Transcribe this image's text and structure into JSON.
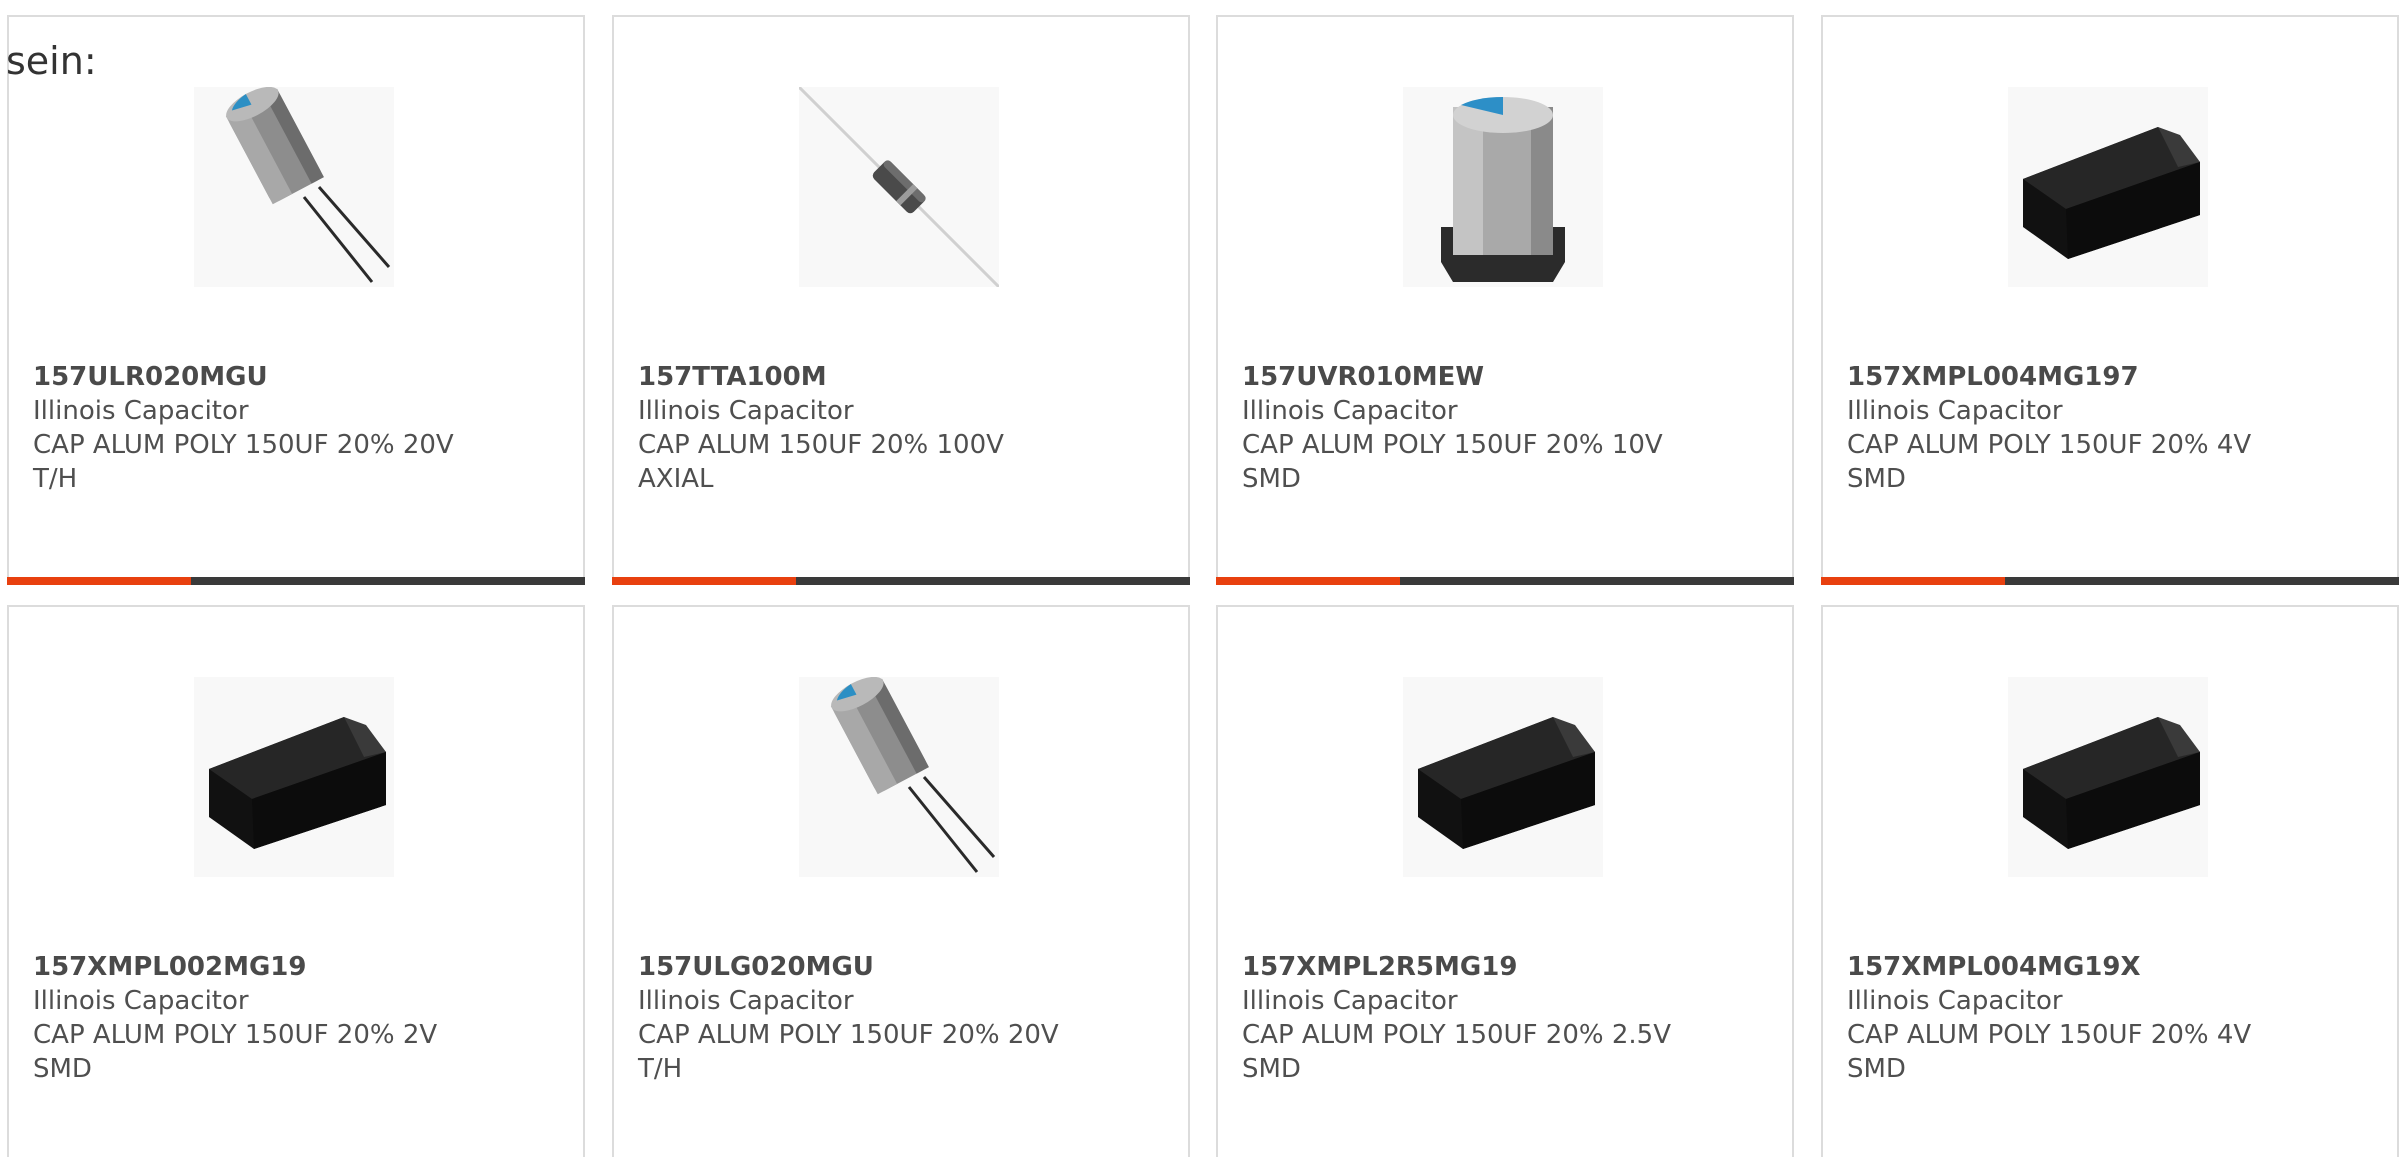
{
  "intro_text": "sein:",
  "colors": {
    "accent": "#e8400f",
    "bar": "#3a3a3a",
    "border": "#dcdcdc"
  },
  "products": [
    {
      "part_number": "157ULR020MGU",
      "manufacturer": "Illinois Capacitor",
      "description": "CAP ALUM POLY 150UF 20% 20V",
      "mount": "T/H",
      "image": "radial-capacitor-image"
    },
    {
      "part_number": "157TTA100M",
      "manufacturer": "Illinois Capacitor",
      "description": "CAP ALUM 150UF 20% 100V",
      "mount": "AXIAL",
      "image": "axial-capacitor-image"
    },
    {
      "part_number": "157UVR010MEW",
      "manufacturer": "Illinois Capacitor",
      "description": "CAP ALUM POLY 150UF 20% 10V",
      "mount": "SMD",
      "image": "smd-can-capacitor-image"
    },
    {
      "part_number": "157XMPL004MG197",
      "manufacturer": "Illinois Capacitor",
      "description": "CAP ALUM POLY 150UF 20% 4V",
      "mount": "SMD",
      "image": "smd-chip-capacitor-image"
    },
    {
      "part_number": "157XMPL002MG19",
      "manufacturer": "Illinois Capacitor",
      "description": "CAP ALUM POLY 150UF 20% 2V",
      "mount": "SMD",
      "image": "smd-chip-capacitor-image"
    },
    {
      "part_number": "157ULG020MGU",
      "manufacturer": "Illinois Capacitor",
      "description": "CAP ALUM POLY 150UF 20% 20V",
      "mount": "T/H",
      "image": "radial-capacitor-image"
    },
    {
      "part_number": "157XMPL2R5MG19",
      "manufacturer": "Illinois Capacitor",
      "description": "CAP ALUM POLY 150UF 20% 2.5V",
      "mount": "SMD",
      "image": "smd-chip-capacitor-image"
    },
    {
      "part_number": "157XMPL004MG19X",
      "manufacturer": "Illinois Capacitor",
      "description": "CAP ALUM POLY 150UF 20% 4V",
      "mount": "SMD",
      "image": "smd-chip-capacitor-image"
    }
  ]
}
